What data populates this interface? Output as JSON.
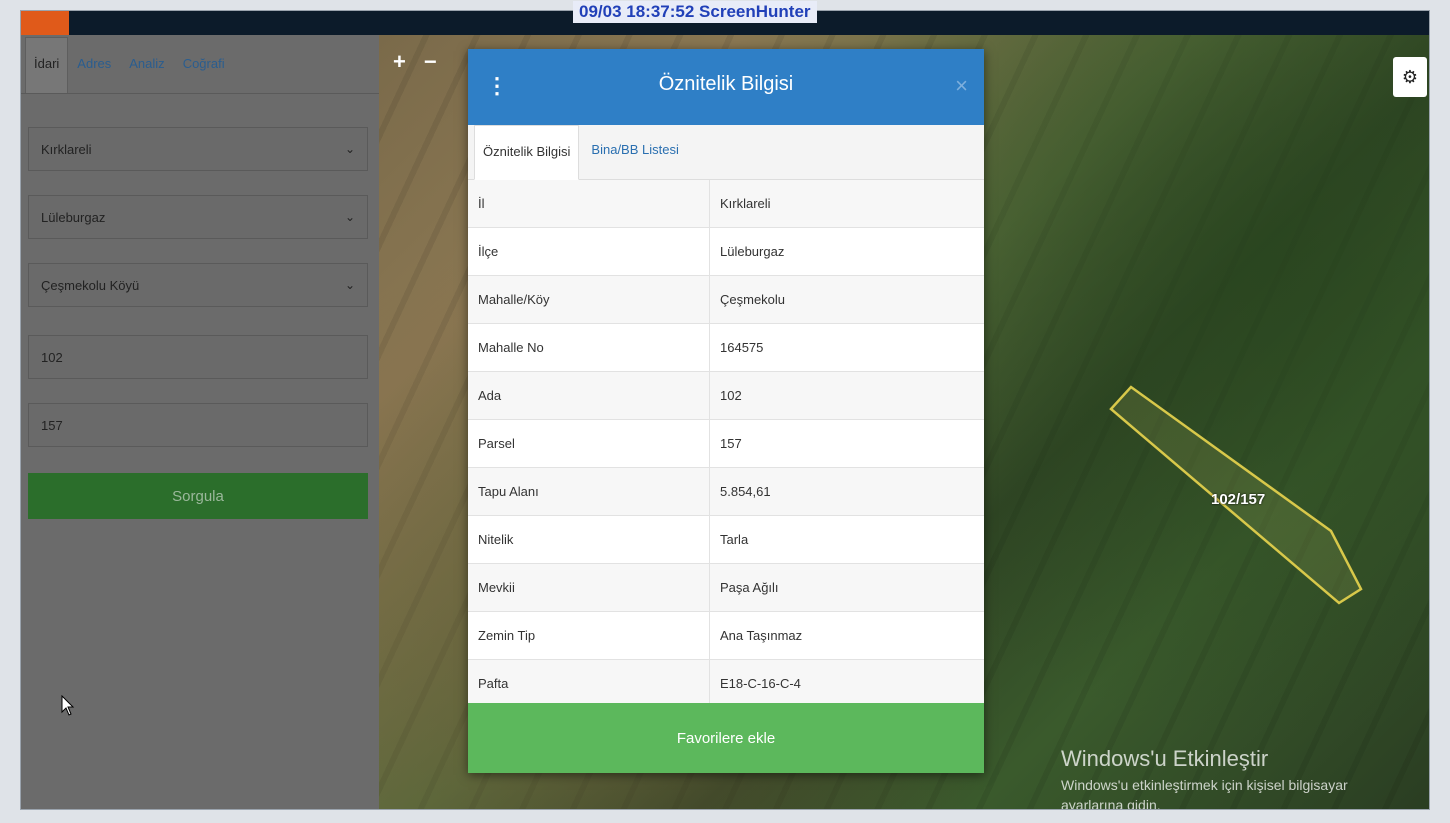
{
  "stamp": "09/03  18:37:52  ScreenHunter",
  "panel": {
    "tabs": [
      "İdari",
      "Adres",
      "Analiz",
      "Coğrafi"
    ],
    "il": "Kırklareli",
    "ilce": "Lüleburgaz",
    "mahalle": "Çeşmekolu Köyü",
    "ada": "102",
    "parsel": "157",
    "query_button": "Sorgula"
  },
  "map": {
    "zoom_in": "+",
    "zoom_out": "−",
    "parcel_label": "102/157",
    "settings_icon": "gear-icon",
    "watermark_title": "Windows'u Etkinleştir",
    "watermark_sub_1": "Windows'u etkinleştirmek için kişisel bilgisayar",
    "watermark_sub_2": "ayarlarına gidin."
  },
  "modal": {
    "title": "Öznitelik Bilgisi",
    "menu_icon": "kebab-menu-icon",
    "close": "×",
    "tabs": [
      "Öznitelik Bilgisi",
      "Bina/BB Listesi"
    ],
    "rows": [
      {
        "label": "İl",
        "value": "Kırklareli"
      },
      {
        "label": "İlçe",
        "value": "Lüleburgaz"
      },
      {
        "label": "Mahalle/Köy",
        "value": "Çeşmekolu"
      },
      {
        "label": "Mahalle No",
        "value": "164575"
      },
      {
        "label": "Ada",
        "value": "102"
      },
      {
        "label": "Parsel",
        "value": "157"
      },
      {
        "label": "Tapu Alanı",
        "value": "5.854,61"
      },
      {
        "label": "Nitelik",
        "value": "Tarla"
      },
      {
        "label": "Mevkii",
        "value": "Paşa Ağılı"
      },
      {
        "label": "Zemin Tip",
        "value": "Ana Taşınmaz"
      },
      {
        "label": "Pafta",
        "value": "E18-C-16-C-4"
      }
    ],
    "favorite_button": "Favorilere ekle"
  }
}
